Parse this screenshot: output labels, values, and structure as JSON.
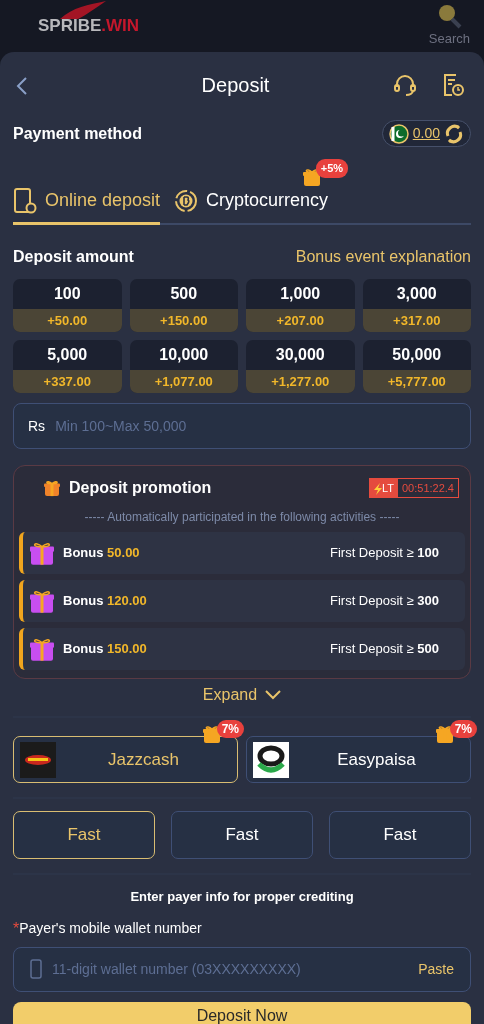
{
  "header": {
    "logo": [
      "SPRIBE",
      ".WIN"
    ],
    "search_label": "Search"
  },
  "title": "Deposit",
  "payment_method": {
    "label": "Payment method",
    "balance": "0.00"
  },
  "tabs": [
    {
      "label": "Online deposit",
      "kind": "phone",
      "selected": true
    },
    {
      "label": "Cryptocurrency",
      "kind": "coin",
      "selected": false,
      "badge": "+5%"
    }
  ],
  "deposit_amount": {
    "label": "Deposit amount",
    "link": "Bonus event explanation"
  },
  "amounts": [
    {
      "amount": "100",
      "bonus": "+50.00"
    },
    {
      "amount": "500",
      "bonus": "+150.00"
    },
    {
      "amount": "1,000",
      "bonus": "+207.00"
    },
    {
      "amount": "3,000",
      "bonus": "+317.00"
    },
    {
      "amount": "5,000",
      "bonus": "+337.00"
    },
    {
      "amount": "10,000",
      "bonus": "+1,077.00"
    },
    {
      "amount": "30,000",
      "bonus": "+1,277.00"
    },
    {
      "amount": "50,000",
      "bonus": "+5,777.00"
    }
  ],
  "amount_field": {
    "prefix": "Rs",
    "placeholder": "Min 100~Max 50,000"
  },
  "promotion": {
    "title": "Deposit promotion",
    "timer_tag": "LT",
    "timer": "00:51:22.4",
    "subtitle": "----- Automatically participated in the following activities -----",
    "items": [
      {
        "label": "Bonus",
        "value": "50.00",
        "condition": "First Deposit ≥ **100**"
      },
      {
        "label": "Bonus",
        "value": "120.00",
        "condition": "First Deposit ≥ **300**"
      },
      {
        "label": "Bonus",
        "value": "150.00",
        "condition": "First Deposit ≥ **500**"
      }
    ]
  },
  "expand": "Expand",
  "channels": [
    {
      "name": "Jazzcash",
      "kind": "jazzcash",
      "badge": "7%",
      "selected": true
    },
    {
      "name": "Easypaisa",
      "kind": "easypaisa",
      "badge": "7%",
      "selected": false
    }
  ],
  "speeds": [
    {
      "label": "Fast",
      "selected": true
    },
    {
      "label": "Fast",
      "selected": false
    },
    {
      "label": "Fast",
      "selected": false
    }
  ],
  "payer_info": {
    "title": "Enter payer info for proper crediting",
    "required_mark": "*",
    "field_label": "Payer's mobile wallet number",
    "placeholder": "11-digit wallet number (03XXXXXXXXX)",
    "paste": "Paste"
  },
  "submit": "Deposit Now"
}
